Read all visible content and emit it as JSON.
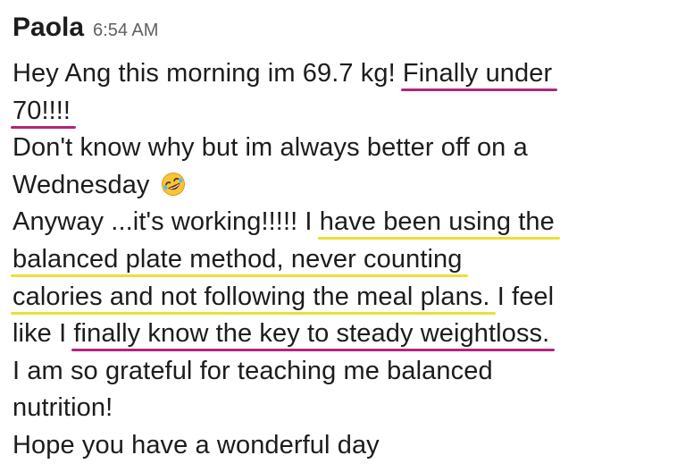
{
  "message": {
    "sender": "Paola",
    "timestamp": "6:54 AM",
    "lines": {
      "l1a": "Hey Ang this morning im 69.7 kg! ",
      "l1b": "Finally under",
      "l2a": "70!!!!",
      "l3": "Don't know why but im always better off on a",
      "l4": "Wednesday",
      "l5a": "Anyway ...it's working!!!!! I ",
      "l5b": "have been using the",
      "l6": "balanced plate method, never counting",
      "l7a": "calories and not following the meal plans.",
      "l7b": " I feel",
      "l8a": "like I ",
      "l8b": "finally know the key to steady weightloss.",
      "l9": "I am so grateful for teaching me balanced",
      "l10": "nutrition!",
      "l11": "Hope you have a wonderful day"
    },
    "emoji_icon": "rolling-on-floor-laughing-emoji",
    "highlight_colors": {
      "magenta": "#b5237c",
      "yellow": "#e8e03a"
    }
  }
}
